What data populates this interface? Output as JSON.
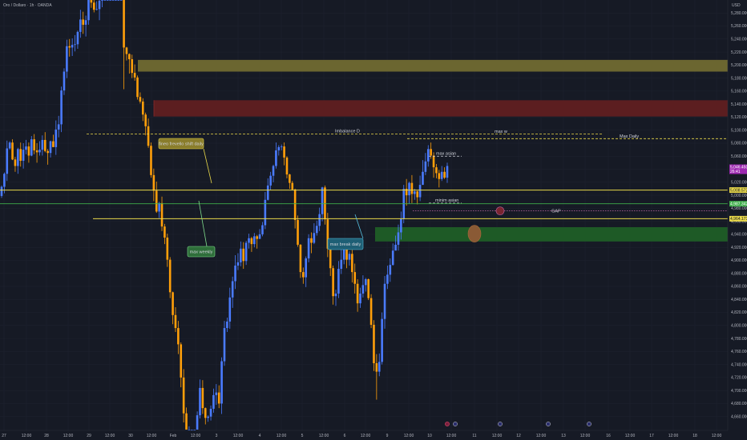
{
  "header": {
    "symbol": "Oro / Dollaro · 1h · OANDA",
    "currency": "USD"
  },
  "chart_data": {
    "type": "candlestick",
    "ylim": [
      4640,
      5300
    ],
    "y_ticks": [
      "5,280.000",
      "5,260.000",
      "5,240.000",
      "5,220.000",
      "5,200.000",
      "5,180.000",
      "5,160.000",
      "5,140.000",
      "5,120.000",
      "5,100.000",
      "5,080.000",
      "5,060.000",
      "5,040.000",
      "5,020.000",
      "5,000.000",
      "4,980.000",
      "4,960.000",
      "4,940.000",
      "4,920.000",
      "4,900.000",
      "4,880.000",
      "4,860.000",
      "4,840.000",
      "4,820.000",
      "4,800.000",
      "4,780.000",
      "4,760.000",
      "4,740.000",
      "4,720.000",
      "4,700.000",
      "4,680.000",
      "4,660.000"
    ],
    "x_ticks": [
      "27",
      "12:00",
      "28",
      "12:00",
      "29",
      "12:00",
      "30",
      "12:00",
      "Feb",
      "12:00",
      "3",
      "12:00",
      "4",
      "12:00",
      "5",
      "12:00",
      "6",
      "12:00",
      "9",
      "12:00",
      "10",
      "12:00",
      "11",
      "12:00",
      "12",
      "12:00",
      "13",
      "12:00",
      "16",
      "12:00",
      "17",
      "12:00",
      "18",
      "12:00"
    ],
    "colors": {
      "up": "#4a7bff",
      "down": "#ff9f0a",
      "bullish_zone": "#1e5a26",
      "bearish_zone": "#5c1e20",
      "olive_zone": "#6b6630",
      "yellow_line": "#e8d84a",
      "green_line": "#3fae4b",
      "pink_line": "#c467a8",
      "current_price": "#9c27b0"
    },
    "zones": [
      {
        "name": "olive-zone",
        "from": 5190,
        "to": 5208
      },
      {
        "name": "red-zone",
        "from": 5121,
        "to": 5146
      },
      {
        "name": "green-zone",
        "from": 4929,
        "to": 4951
      }
    ],
    "levels": [
      {
        "name": "imbalance-d-line",
        "value": 5094,
        "style": "dashed",
        "label": "Imbalance D"
      },
      {
        "name": "max-w-line",
        "value": 5094,
        "style": "dashed",
        "label": "max w"
      },
      {
        "name": "max-daily-line",
        "value": 5087,
        "style": "dashed",
        "label": "Max Daily"
      },
      {
        "name": "max-asian-line",
        "value": 5060,
        "style": "dashed",
        "label": "max asian"
      },
      {
        "name": "yellow-level-1",
        "value": 5008,
        "style": "solid"
      },
      {
        "name": "minim-asian-line",
        "value": 4988,
        "style": "dashed",
        "label": "minim asian"
      },
      {
        "name": "green-level",
        "value": 4987,
        "style": "solid"
      },
      {
        "name": "gap-line",
        "value": 4976,
        "style": "dotted",
        "label": "GAP"
      },
      {
        "name": "yellow-level-2",
        "value": 4964,
        "style": "solid"
      }
    ],
    "price_tags": [
      {
        "name": "current-price-tag",
        "text": "5,046.450",
        "sub": "26:41",
        "value": 5040,
        "color": "#9c27b0"
      },
      {
        "name": "yellow-tag-1",
        "text": "5,008.572",
        "value": 5008,
        "color": "#e8d84a"
      },
      {
        "name": "green-tag",
        "text": "4,987.342",
        "value": 4987,
        "color": "#3fae4b"
      },
      {
        "name": "yellow-tag-2",
        "text": "4,964.173",
        "value": 4964,
        "color": "#e8d84a"
      }
    ],
    "callouts": [
      {
        "name": "fineo-frevello-callout",
        "text": "fineo frevello shift daily"
      },
      {
        "name": "max-weekly-callout",
        "text": "max weekly"
      },
      {
        "name": "max-break-daily-callout",
        "text": "max break daily"
      }
    ],
    "candles": [
      [
        4999,
        5013,
        4996,
        5015
      ],
      [
        5013,
        5033,
        5003,
        5035
      ],
      [
        5033,
        5072,
        5022,
        5084
      ],
      [
        5072,
        5081,
        5070,
        5083
      ],
      [
        5081,
        5055,
        5054,
        5086
      ],
      [
        5055,
        5045,
        5036,
        5059
      ],
      [
        5045,
        5071,
        5033,
        5073
      ],
      [
        5071,
        5053,
        5044,
        5081
      ],
      [
        5053,
        5070,
        5041,
        5080
      ],
      [
        5070,
        5075,
        5063,
        5085
      ],
      [
        5075,
        5061,
        5050,
        5081
      ],
      [
        5061,
        5086,
        5060,
        5091
      ],
      [
        5086,
        5069,
        5063,
        5094
      ],
      [
        5069,
        5066,
        5050,
        5080
      ],
      [
        5066,
        5070,
        5061,
        5083
      ],
      [
        5070,
        5085,
        5061,
        5092
      ],
      [
        5085,
        5068,
        5066,
        5097
      ],
      [
        5068,
        5065,
        5047,
        5071
      ],
      [
        5065,
        5083,
        5058,
        5084
      ],
      [
        5083,
        5074,
        5074,
        5093
      ],
      [
        5074,
        5101,
        5062,
        5115
      ],
      [
        5101,
        5109,
        5089,
        5122
      ],
      [
        5109,
        5161,
        5097,
        5167
      ],
      [
        5161,
        5190,
        5154,
        5195
      ],
      [
        5190,
        5229,
        5180,
        5239
      ],
      [
        5229,
        5227,
        5213,
        5240
      ],
      [
        5227,
        5231,
        5214,
        5241
      ],
      [
        5231,
        5232,
        5221,
        5246
      ],
      [
        5232,
        5251,
        5225,
        5253
      ],
      [
        5251,
        5270,
        5242,
        5285
      ],
      [
        5270,
        5262,
        5248,
        5282
      ],
      [
        5262,
        5269,
        5244,
        5276
      ],
      [
        5269,
        5300,
        5262,
        5300
      ],
      [
        5300,
        5296,
        5288,
        5300
      ],
      [
        5296,
        5285,
        5281,
        5300
      ],
      [
        5285,
        5286,
        5284,
        5298
      ],
      [
        5286,
        5299,
        5269,
        5300
      ],
      [
        5299,
        5300,
        5289,
        5300
      ],
      [
        5300,
        5300,
        5300,
        5300
      ],
      [
        5300,
        5300,
        5300,
        5300
      ],
      [
        5300,
        5300,
        5300,
        5300
      ],
      [
        5300,
        5300,
        5300,
        5300
      ],
      [
        5300,
        5300,
        5300,
        5300
      ],
      [
        5300,
        5300,
        5300,
        5300
      ],
      [
        5300,
        5300,
        5300,
        5300
      ],
      [
        5300,
        5227,
        5163,
        5300
      ],
      [
        5227,
        5217,
        5207,
        5228
      ],
      [
        5217,
        5209,
        5187,
        5218
      ],
      [
        5209,
        5188,
        5180,
        5216
      ],
      [
        5188,
        5181,
        5176,
        5201
      ],
      [
        5181,
        5151,
        5147,
        5184
      ],
      [
        5151,
        5144,
        5141,
        5158
      ],
      [
        5144,
        5124,
        5114,
        5149
      ],
      [
        5124,
        5106,
        5092,
        5127
      ],
      [
        5106,
        5076,
        5073,
        5118
      ],
      [
        5076,
        5031,
        5027,
        5081
      ],
      [
        5031,
        5007,
        4991,
        5041
      ],
      [
        5007,
        4975,
        4973,
        5021
      ],
      [
        4975,
        4988,
        4965,
        4990
      ],
      [
        4988,
        4952,
        4945,
        4998
      ],
      [
        4952,
        4935,
        4925,
        4956
      ],
      [
        4935,
        4901,
        4890,
        4941
      ],
      [
        4901,
        4851,
        4842,
        4905
      ],
      [
        4851,
        4816,
        4802,
        4852
      ],
      [
        4816,
        4796,
        4790,
        4828
      ],
      [
        4796,
        4771,
        4756,
        4807
      ],
      [
        4771,
        4720,
        4705,
        4774
      ],
      [
        4720,
        4665,
        4651,
        4733
      ],
      [
        4665,
        4640,
        4640,
        4674
      ],
      [
        4640,
        4640,
        4640,
        4645
      ],
      [
        4640,
        4640,
        4640,
        4640
      ],
      [
        4640,
        4640,
        4640,
        4640
      ],
      [
        4640,
        4662,
        4640,
        4668
      ],
      [
        4662,
        4704,
        4657,
        4717
      ],
      [
        4704,
        4673,
        4664,
        4716
      ],
      [
        4673,
        4658,
        4648,
        4674
      ],
      [
        4658,
        4660,
        4652,
        4662
      ],
      [
        4660,
        4672,
        4654,
        4677
      ],
      [
        4672,
        4693,
        4666,
        4703
      ],
      [
        4693,
        4697,
        4678,
        4710
      ],
      [
        4697,
        4680,
        4673,
        4708
      ],
      [
        4680,
        4745,
        4664,
        4751
      ],
      [
        4745,
        4796,
        4738,
        4807
      ],
      [
        4796,
        4806,
        4790,
        4812
      ],
      [
        4806,
        4843,
        4795,
        4858
      ],
      [
        4843,
        4868,
        4827,
        4875
      ],
      [
        4868,
        4892,
        4856,
        4908
      ],
      [
        4892,
        4897,
        4885,
        4911
      ],
      [
        4897,
        4918,
        4891,
        4929
      ],
      [
        4918,
        4899,
        4887,
        4928
      ],
      [
        4899,
        4927,
        4893,
        4930
      ],
      [
        4927,
        4934,
        4918,
        4941
      ],
      [
        4934,
        4925,
        4913,
        4936
      ],
      [
        4925,
        4937,
        4920,
        4942
      ],
      [
        4937,
        4933,
        4918,
        4939
      ],
      [
        4933,
        4940,
        4933,
        4948
      ],
      [
        4940,
        4954,
        4937,
        4959
      ],
      [
        4954,
        4993,
        4948,
        5005
      ],
      [
        4993,
        5015,
        4992,
        5026
      ],
      [
        5015,
        5030,
        5008,
        5036
      ],
      [
        5030,
        5045,
        5020,
        5047
      ],
      [
        5045,
        5069,
        5041,
        5081
      ],
      [
        5069,
        5074,
        5061,
        5077
      ],
      [
        5074,
        5075,
        5069,
        5078
      ],
      [
        5075,
        5058,
        5046,
        5081
      ],
      [
        5058,
        5032,
        5026,
        5060
      ],
      [
        5032,
        5019,
        5010,
        5033
      ],
      [
        5019,
        5009,
        5008,
        5022
      ],
      [
        5009,
        4962,
        4949,
        5010
      ],
      [
        4962,
        4924,
        4921,
        4969
      ],
      [
        4924,
        4882,
        4873,
        4925
      ],
      [
        4882,
        4874,
        4864,
        4889
      ],
      [
        4874,
        4903,
        4859,
        4906
      ],
      [
        4903,
        4934,
        4897,
        4940
      ],
      [
        4934,
        4927,
        4911,
        4943
      ],
      [
        4927,
        4942,
        4925,
        4957
      ],
      [
        4942,
        4953,
        4938,
        4961
      ],
      [
        4953,
        4971,
        4945,
        4981
      ],
      [
        4971,
        5012,
        4960,
        5013
      ],
      [
        5012,
        4963,
        4955,
        5015
      ],
      [
        4963,
        4918,
        4905,
        4973
      ],
      [
        4918,
        4888,
        4876,
        4926
      ],
      [
        4888,
        4845,
        4832,
        4892
      ],
      [
        4845,
        4849,
        4830,
        4855
      ],
      [
        4849,
        4887,
        4842,
        4899
      ],
      [
        4887,
        4901,
        4879,
        4917
      ],
      [
        4901,
        4922,
        4894,
        4926
      ],
      [
        4922,
        4901,
        4888,
        4924
      ],
      [
        4901,
        4910,
        4892,
        4914
      ],
      [
        4910,
        4882,
        4866,
        4916
      ],
      [
        4882,
        4864,
        4849,
        4895
      ],
      [
        4864,
        4834,
        4821,
        4871
      ],
      [
        4834,
        4849,
        4827,
        4858
      ],
      [
        4849,
        4862,
        4843,
        4877
      ],
      [
        4862,
        4871,
        4852,
        4873
      ],
      [
        4871,
        4842,
        4839,
        4872
      ],
      [
        4842,
        4801,
        4796,
        4848
      ],
      [
        4801,
        4742,
        4730,
        4808
      ],
      [
        4742,
        4729,
        4686,
        4756
      ],
      [
        4729,
        4744,
        4722,
        4757
      ],
      [
        4744,
        4810,
        4740,
        4820
      ],
      [
        4810,
        4864,
        4795,
        4876
      ],
      [
        4864,
        4878,
        4856,
        4892
      ],
      [
        4878,
        4893,
        4867,
        4903
      ],
      [
        4893,
        4915,
        4892,
        4926
      ],
      [
        4915,
        4924,
        4916,
        4938
      ],
      [
        4924,
        4943,
        4915,
        4955
      ],
      [
        4943,
        4964,
        4932,
        4975
      ],
      [
        4964,
        5010,
        4957,
        5016
      ],
      [
        5010,
        5000,
        4984,
        5025
      ],
      [
        5000,
        5019,
        4987,
        5021
      ],
      [
        5019,
        5002,
        4988,
        5031
      ],
      [
        5002,
        5006,
        4993,
        5010
      ],
      [
        5006,
        4997,
        4986,
        5007
      ],
      [
        4997,
        5016,
        4991,
        5030
      ],
      [
        5016,
        5036,
        5016,
        5054
      ],
      [
        5036,
        5052,
        5031,
        5065
      ],
      [
        5052,
        5071,
        5044,
        5077
      ],
      [
        5071,
        5061,
        5056,
        5081
      ],
      [
        5061,
        5043,
        5027,
        5066
      ],
      [
        5043,
        5034,
        5026,
        5048
      ],
      [
        5034,
        5025,
        5012,
        5039
      ],
      [
        5025,
        5036,
        5022,
        5045
      ],
      [
        5036,
        5027,
        5025,
        5043
      ],
      [
        5027,
        5045,
        5019,
        5050
      ]
    ]
  }
}
